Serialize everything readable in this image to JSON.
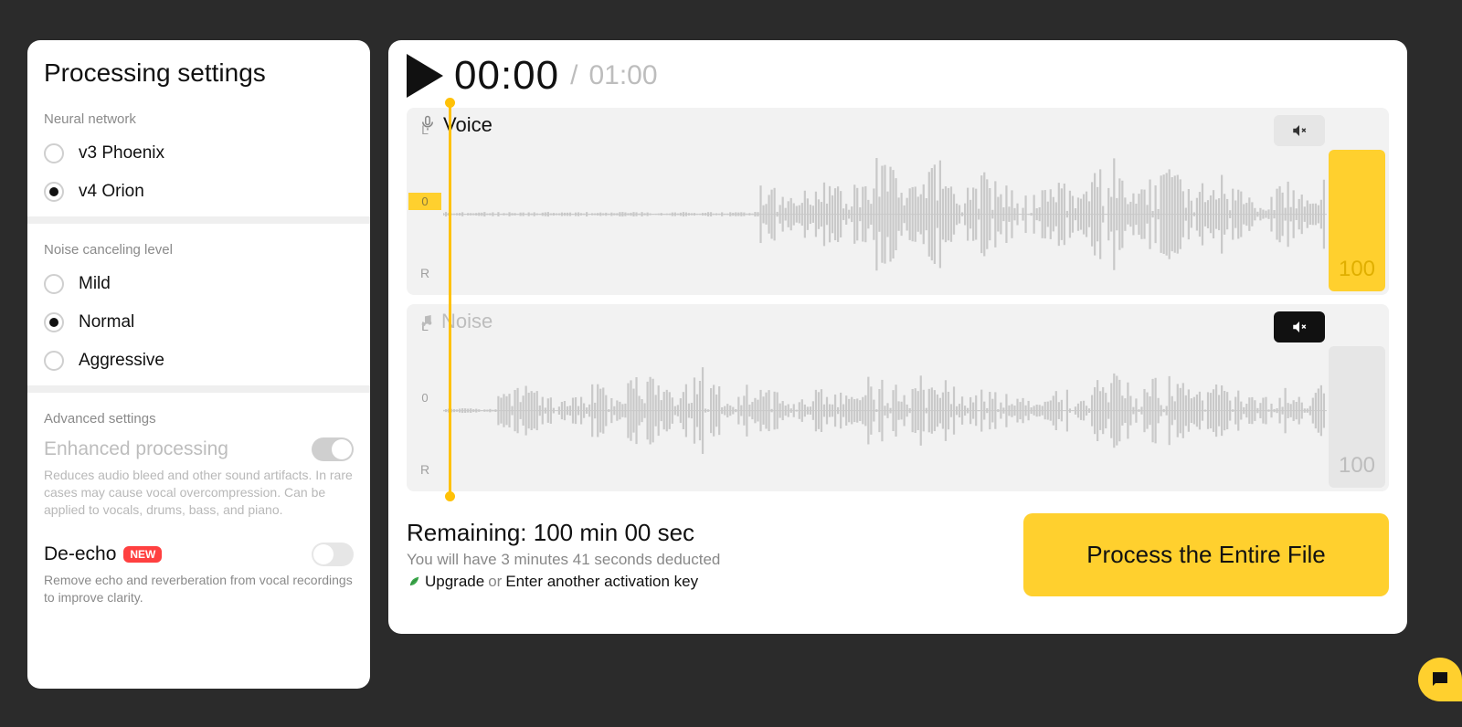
{
  "settings": {
    "title": "Processing settings",
    "neural_label": "Neural network",
    "neural_options": [
      {
        "label": "v3 Phoenix",
        "checked": false
      },
      {
        "label": "v4 Orion",
        "checked": true
      }
    ],
    "noise_label": "Noise canceling level",
    "noise_options": [
      {
        "label": "Mild",
        "checked": false
      },
      {
        "label": "Normal",
        "checked": true
      },
      {
        "label": "Aggressive",
        "checked": false
      }
    ],
    "advanced_label": "Advanced settings",
    "enhanced": {
      "title": "Enhanced processing",
      "desc": "Reduces audio bleed and other sound artifacts. In rare cases may cause vocal overcompression. Can be applied to vocals, drums, bass, and piano.",
      "on": true,
      "disabled": true
    },
    "deecho": {
      "title": "De-echo",
      "badge": "NEW",
      "desc": "Remove echo and reverberation from vocal recordings to improve clarity.",
      "on": false
    }
  },
  "player": {
    "time_current": "00:00",
    "time_separator": "/",
    "time_total": "01:00",
    "tracks": {
      "voice": {
        "label": "Voice",
        "muted": false,
        "volume": 100
      },
      "noise": {
        "label": "Noise",
        "muted": true,
        "volume": 100
      }
    },
    "channels": {
      "left": "L",
      "zero": "0",
      "right": "R"
    },
    "footer": {
      "remaining": "Remaining: 100 min 00 sec",
      "deducted": "You will have 3 minutes 41 seconds deducted",
      "upgrade": "Upgrade",
      "or": "or",
      "enter_key": "Enter another activation key",
      "process_btn": "Process the Entire File"
    }
  }
}
